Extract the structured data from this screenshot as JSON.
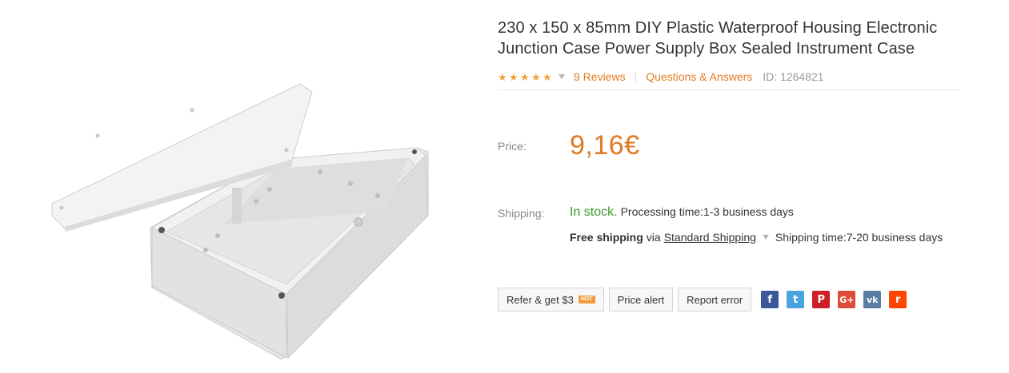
{
  "product": {
    "title_line1": "230 x 150 x 85mm DIY Plastic Waterproof Housing Electronic",
    "title_line2": "Junction Case Power Supply Box Sealed Instrument Case",
    "rating": 5,
    "reviews_label": "9 Reviews",
    "qa_label": "Questions & Answers",
    "id_label": "ID: 1264821"
  },
  "price": {
    "label": "Price:",
    "value": "9,16€",
    "color": "#e07b23"
  },
  "shipping": {
    "label": "Shipping:",
    "in_stock": "In stock.",
    "processing": "Processing time:1-3 business days",
    "free": "Free shipping",
    "via": "via",
    "method": "Standard Shipping",
    "shipping_time": "Shipping time:7-20 business days"
  },
  "actions": {
    "refer": "Refer & get $3",
    "hot": "HOT",
    "price_alert": "Price alert",
    "report_error": "Report error"
  },
  "socials": [
    {
      "name": "facebook-icon",
      "glyph": "f",
      "color": "#3b5998"
    },
    {
      "name": "twitter-icon",
      "glyph": "t",
      "color": "#4aa3df"
    },
    {
      "name": "pinterest-icon",
      "glyph": "P",
      "color": "#cb2027"
    },
    {
      "name": "google-plus-icon",
      "glyph": "G+",
      "color": "#dd4b39"
    },
    {
      "name": "vk-icon",
      "glyph": "vk",
      "color": "#587ca3"
    },
    {
      "name": "reddit-icon",
      "glyph": "r",
      "color": "#ff4500"
    }
  ]
}
